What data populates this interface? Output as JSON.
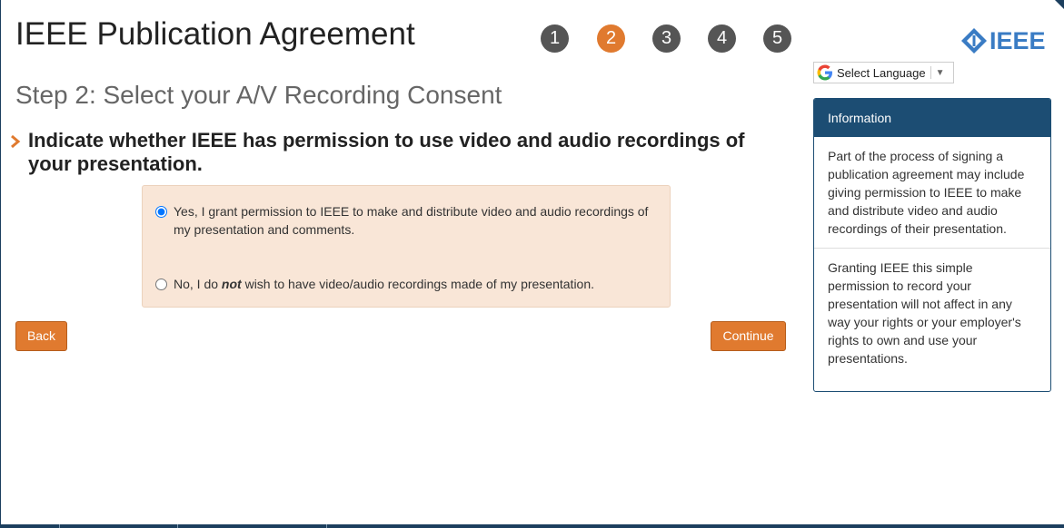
{
  "header": {
    "title": "IEEE Publication Agreement",
    "steps": [
      "1",
      "2",
      "3",
      "4",
      "5"
    ],
    "active_step": "2",
    "logo_text": "IEEE"
  },
  "language": {
    "label": "Select Language",
    "arrow": "▼"
  },
  "step": {
    "title": "Step 2: Select your A/V Recording Consent"
  },
  "question": {
    "chevron": "›",
    "text": "Indicate whether IEEE has permission to use video and audio recordings of your presentation."
  },
  "options": {
    "yes": {
      "label": "Yes, I grant permission to IEEE to make and distribute video and audio recordings of my presentation and comments.",
      "checked": true
    },
    "no": {
      "prefix": "No, I do ",
      "emphasis": "not",
      "suffix": " wish to have video/audio recordings made of my presentation.",
      "checked": false
    }
  },
  "buttons": {
    "back": "Back",
    "continue": "Continue"
  },
  "info": {
    "heading": "Information",
    "paragraphs": [
      "Part of the process of signing a publication agreement may include giving permission to IEEE to make and distribute video and audio recordings of their presentation.",
      "Granting IEEE this simple permission to record your presentation will not affect in any way your rights or your employer's rights to own and use your presentations."
    ]
  },
  "colors": {
    "accent": "#e07a2f",
    "navy": "#1c4d73",
    "option_bg": "#f9e6d7",
    "ieee_blue": "#3a7cc4"
  }
}
